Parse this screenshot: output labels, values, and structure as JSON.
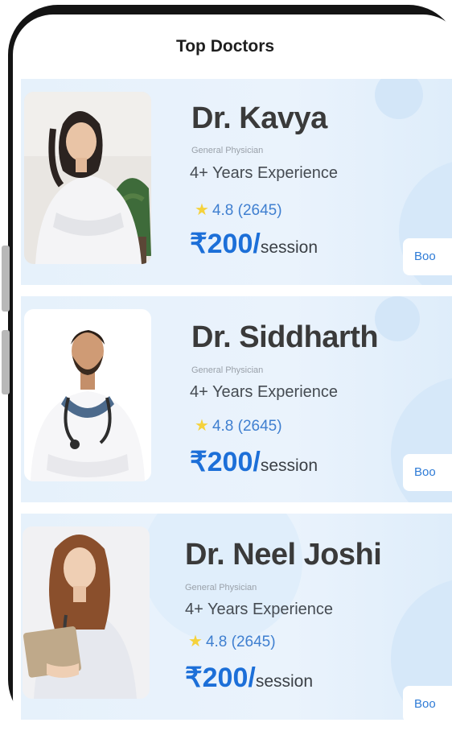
{
  "header": {
    "title": "Top Doctors"
  },
  "doctors": [
    {
      "name": "Dr. Kavya",
      "specialty": "General Physician",
      "experience": "4+ Years Experience",
      "rating": "4.8",
      "reviews": "(2645)",
      "price": "₹200/",
      "price_unit": "session",
      "book_label": "Boo"
    },
    {
      "name": "Dr. Siddharth",
      "specialty": "General Physician",
      "experience": "4+ Years Experience",
      "rating": "4.8",
      "reviews": "(2645)",
      "price": "₹200/",
      "price_unit": "session",
      "book_label": "Boo"
    },
    {
      "name": "Dr. Neel Joshi",
      "specialty": "General Physician",
      "experience": "4+ Years Experience",
      "rating": "4.8",
      "reviews": "(2645)",
      "price": "₹200/",
      "price_unit": "session",
      "book_label": "Boo"
    }
  ],
  "colors": {
    "accent": "#1c6fd8",
    "card_bg": "#e6f1fb",
    "star": "#f5d23c",
    "frame": "#141414"
  },
  "icons": {
    "rating": "star-icon"
  }
}
